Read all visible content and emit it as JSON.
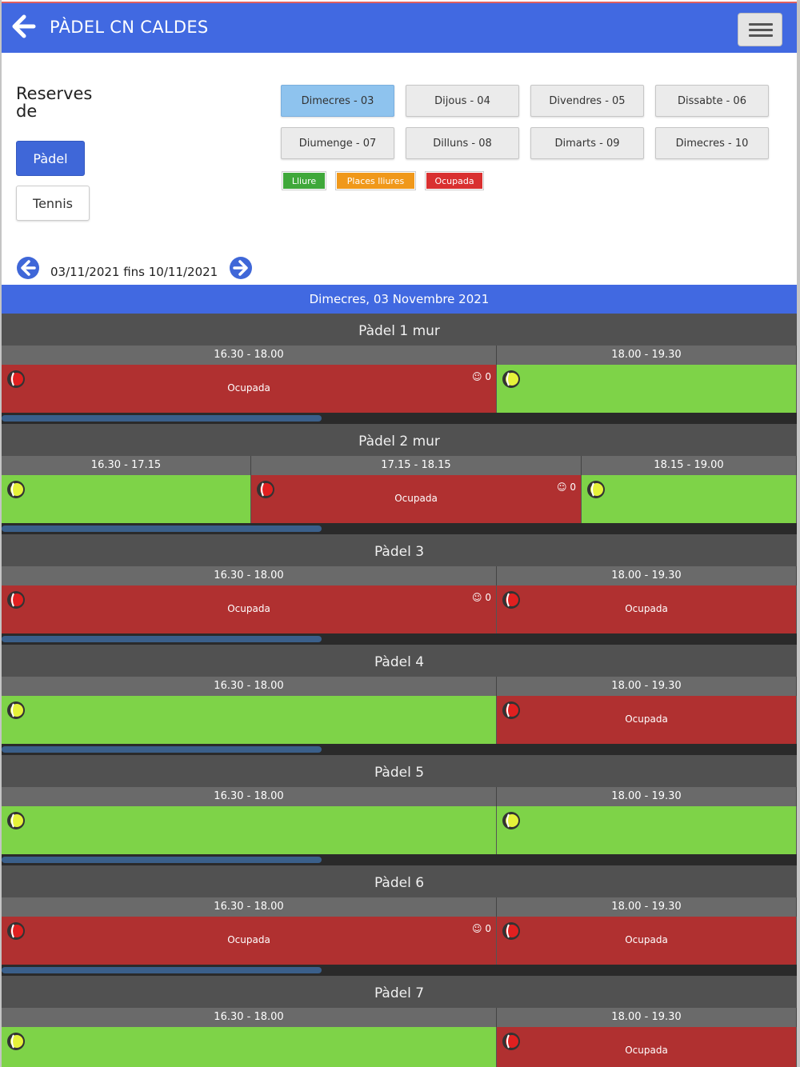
{
  "header": {
    "title": "PÀDEL CN CALDES",
    "back_icon": "arrow-left-icon",
    "menu_icon": "hamburger-icon",
    "color": "#4169e1"
  },
  "reserves": {
    "title": "Reserves de",
    "sports": [
      {
        "label": "Pàdel",
        "active": true
      },
      {
        "label": "Tennis",
        "active": false
      }
    ]
  },
  "days": [
    {
      "label": "Dimecres - 03",
      "selected": true
    },
    {
      "label": "Dijous - 04",
      "selected": false
    },
    {
      "label": "Divendres - 05",
      "selected": false
    },
    {
      "label": "Dissabte - 06",
      "selected": false
    },
    {
      "label": "Diumenge - 07",
      "selected": false
    },
    {
      "label": "Dilluns - 08",
      "selected": false
    },
    {
      "label": "Dimarts - 09",
      "selected": false
    },
    {
      "label": "Dimecres - 10",
      "selected": false
    }
  ],
  "legend": [
    {
      "label": "Lliure",
      "color": "#3fa83a"
    },
    {
      "label": "Places lliures",
      "color": "#f0981a"
    },
    {
      "label": "Ocupada",
      "color": "#d93030"
    }
  ],
  "date_nav": {
    "range": "03/11/2021 fins 10/11/2021",
    "prev_icon": "circle-arrow-left-icon",
    "next_icon": "circle-arrow-right-icon"
  },
  "schedule": {
    "day_title": "Dimecres, 03 Novembre 2021",
    "colors": {
      "free": "#7ed348",
      "busy": "#b03030"
    },
    "courts": [
      {
        "name": "Pàdel 1 mur",
        "slots": [
          {
            "time": "16.30 - 18.00",
            "status": "busy",
            "label": "Ocupada",
            "players": "0"
          },
          {
            "time": "18.00 - 19.30",
            "status": "free",
            "label": "",
            "players": ""
          }
        ]
      },
      {
        "name": "Pàdel 2 mur",
        "slots": [
          {
            "time": "16.30 - 17.15",
            "status": "free",
            "label": "",
            "players": ""
          },
          {
            "time": "17.15 - 18.15",
            "status": "busy",
            "label": "Ocupada",
            "players": "0"
          },
          {
            "time": "18.15 - 19.00",
            "status": "free",
            "label": "",
            "players": ""
          }
        ]
      },
      {
        "name": "Pàdel 3",
        "slots": [
          {
            "time": "16.30 - 18.00",
            "status": "busy",
            "label": "Ocupada",
            "players": "0"
          },
          {
            "time": "18.00 - 19.30",
            "status": "busy",
            "label": "Ocupada",
            "players": ""
          }
        ]
      },
      {
        "name": "Pàdel 4",
        "slots": [
          {
            "time": "16.30 - 18.00",
            "status": "free",
            "label": "",
            "players": ""
          },
          {
            "time": "18.00 - 19.30",
            "status": "busy",
            "label": "Ocupada",
            "players": ""
          }
        ]
      },
      {
        "name": "Pàdel 5",
        "slots": [
          {
            "time": "16.30 - 18.00",
            "status": "free",
            "label": "",
            "players": ""
          },
          {
            "time": "18.00 - 19.30",
            "status": "free",
            "label": "",
            "players": ""
          }
        ]
      },
      {
        "name": "Pàdel 6",
        "slots": [
          {
            "time": "16.30 - 18.00",
            "status": "busy",
            "label": "Ocupada",
            "players": "0"
          },
          {
            "time": "18.00 - 19.30",
            "status": "busy",
            "label": "Ocupada",
            "players": ""
          }
        ]
      },
      {
        "name": "Pàdel 7",
        "slots": [
          {
            "time": "16.30 - 18.00",
            "status": "free",
            "label": "",
            "players": ""
          },
          {
            "time": "18.00 - 19.30",
            "status": "busy",
            "label": "Ocupada",
            "players": ""
          }
        ]
      }
    ]
  }
}
